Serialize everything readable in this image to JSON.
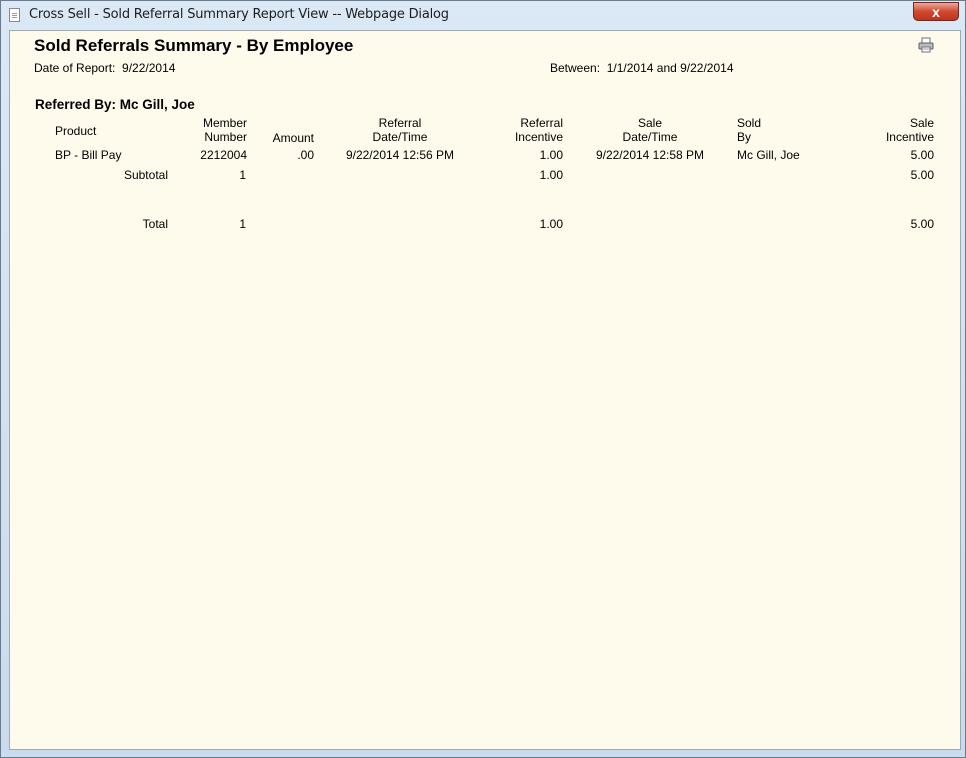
{
  "window": {
    "title": "Cross Sell - Sold Referral Summary Report View -- Webpage Dialog",
    "close_glyph": "x"
  },
  "report": {
    "title": "Sold Referrals Summary - By Employee",
    "date_label": "Date of Report:",
    "date_value": "9/22/2014",
    "between_label": "Between:",
    "between_value": "1/1/2014 and 9/22/2014",
    "section_label": "Referred By: Mc Gill, Joe",
    "icons": [
      "print-icon"
    ]
  },
  "table": {
    "columns": [
      {
        "line1": "",
        "line2": "Product"
      },
      {
        "line1": "Member",
        "line2": "Number"
      },
      {
        "line1": "",
        "line2": "Amount"
      },
      {
        "line1": "Referral",
        "line2": "Date/Time"
      },
      {
        "line1": "Referral",
        "line2": "Incentive"
      },
      {
        "line1": "Sale",
        "line2": "Date/Time"
      },
      {
        "line1": "Sold",
        "line2": "By"
      },
      {
        "line1": "Sale",
        "line2": "Incentive"
      }
    ],
    "rows": [
      {
        "product": "BP - Bill Pay",
        "member_number": "2212004",
        "amount": ".00",
        "referral_datetime": "9/22/2014 12:56 PM",
        "referral_incentive": "1.00",
        "sale_datetime": "9/22/2014 12:58 PM",
        "sold_by": "Mc Gill, Joe",
        "sale_incentive": "5.00"
      }
    ],
    "subtotal": {
      "label": "Subtotal",
      "count": "1",
      "referral_incentive": "1.00",
      "sale_incentive": "5.00"
    },
    "total": {
      "label": "Total",
      "count": "1",
      "referral_incentive": "1.00",
      "sale_incentive": "5.00"
    }
  }
}
